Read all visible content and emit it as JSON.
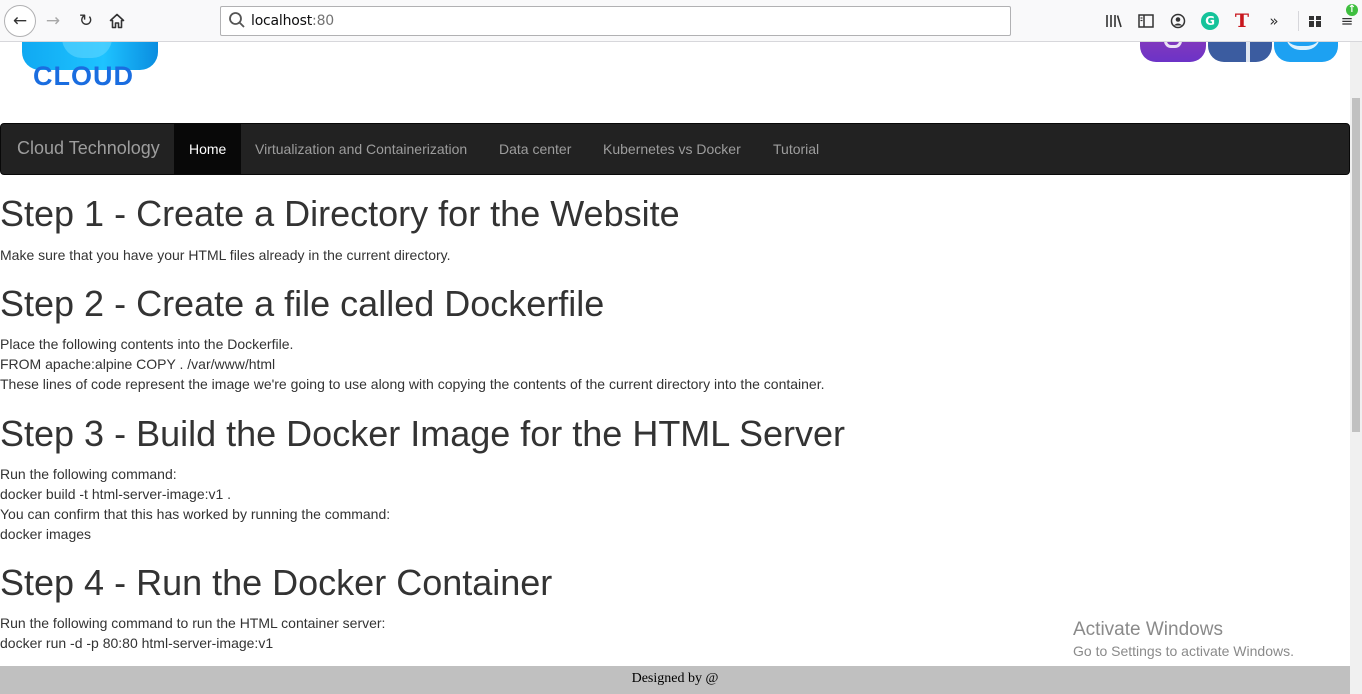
{
  "browser": {
    "url_host": "localhost",
    "url_port": ":80"
  },
  "logo": {
    "text": "CLOUD"
  },
  "navbar": {
    "brand": "Cloud Technology",
    "items": [
      {
        "label": "Home",
        "active": true
      },
      {
        "label": "Virtualization and Containerization",
        "active": false
      },
      {
        "label": "Data center",
        "active": false
      },
      {
        "label": "Kubernetes vs Docker",
        "active": false
      },
      {
        "label": "Tutorial",
        "active": false
      }
    ]
  },
  "sections": [
    {
      "title": "Step 1 - Create a Directory for the Website",
      "lines": [
        "Make sure that you have your HTML files already in the current directory."
      ]
    },
    {
      "title": "Step 2 - Create a file called Dockerfile",
      "lines": [
        "Place the following contents into the Dockerfile.",
        "FROM apache:alpine COPY . /var/www/html",
        "These lines of code represent the image we're going to use along with copying the contents of the current directory into the container."
      ]
    },
    {
      "title": "Step 3 - Build the Docker Image for the HTML Server",
      "lines": [
        "Run the following command:",
        "docker build -t html-server-image:v1 .",
        "You can confirm that this has worked by running the command:",
        "docker images"
      ]
    },
    {
      "title": "Step 4 - Run the Docker Container",
      "lines": [
        "Run the following command to run the HTML container server:",
        "docker run -d -p 80:80 html-server-image:v1"
      ]
    }
  ],
  "footer": {
    "text": "Designed by @"
  },
  "watermark": {
    "title": "Activate Windows",
    "subtitle": "Go to Settings to activate Windows."
  },
  "colors": {
    "navbar_bg": "#222222",
    "nav_active_bg": "#080808",
    "footer_bg": "#c0c0c0",
    "logo_blue": "#1a6de0"
  }
}
